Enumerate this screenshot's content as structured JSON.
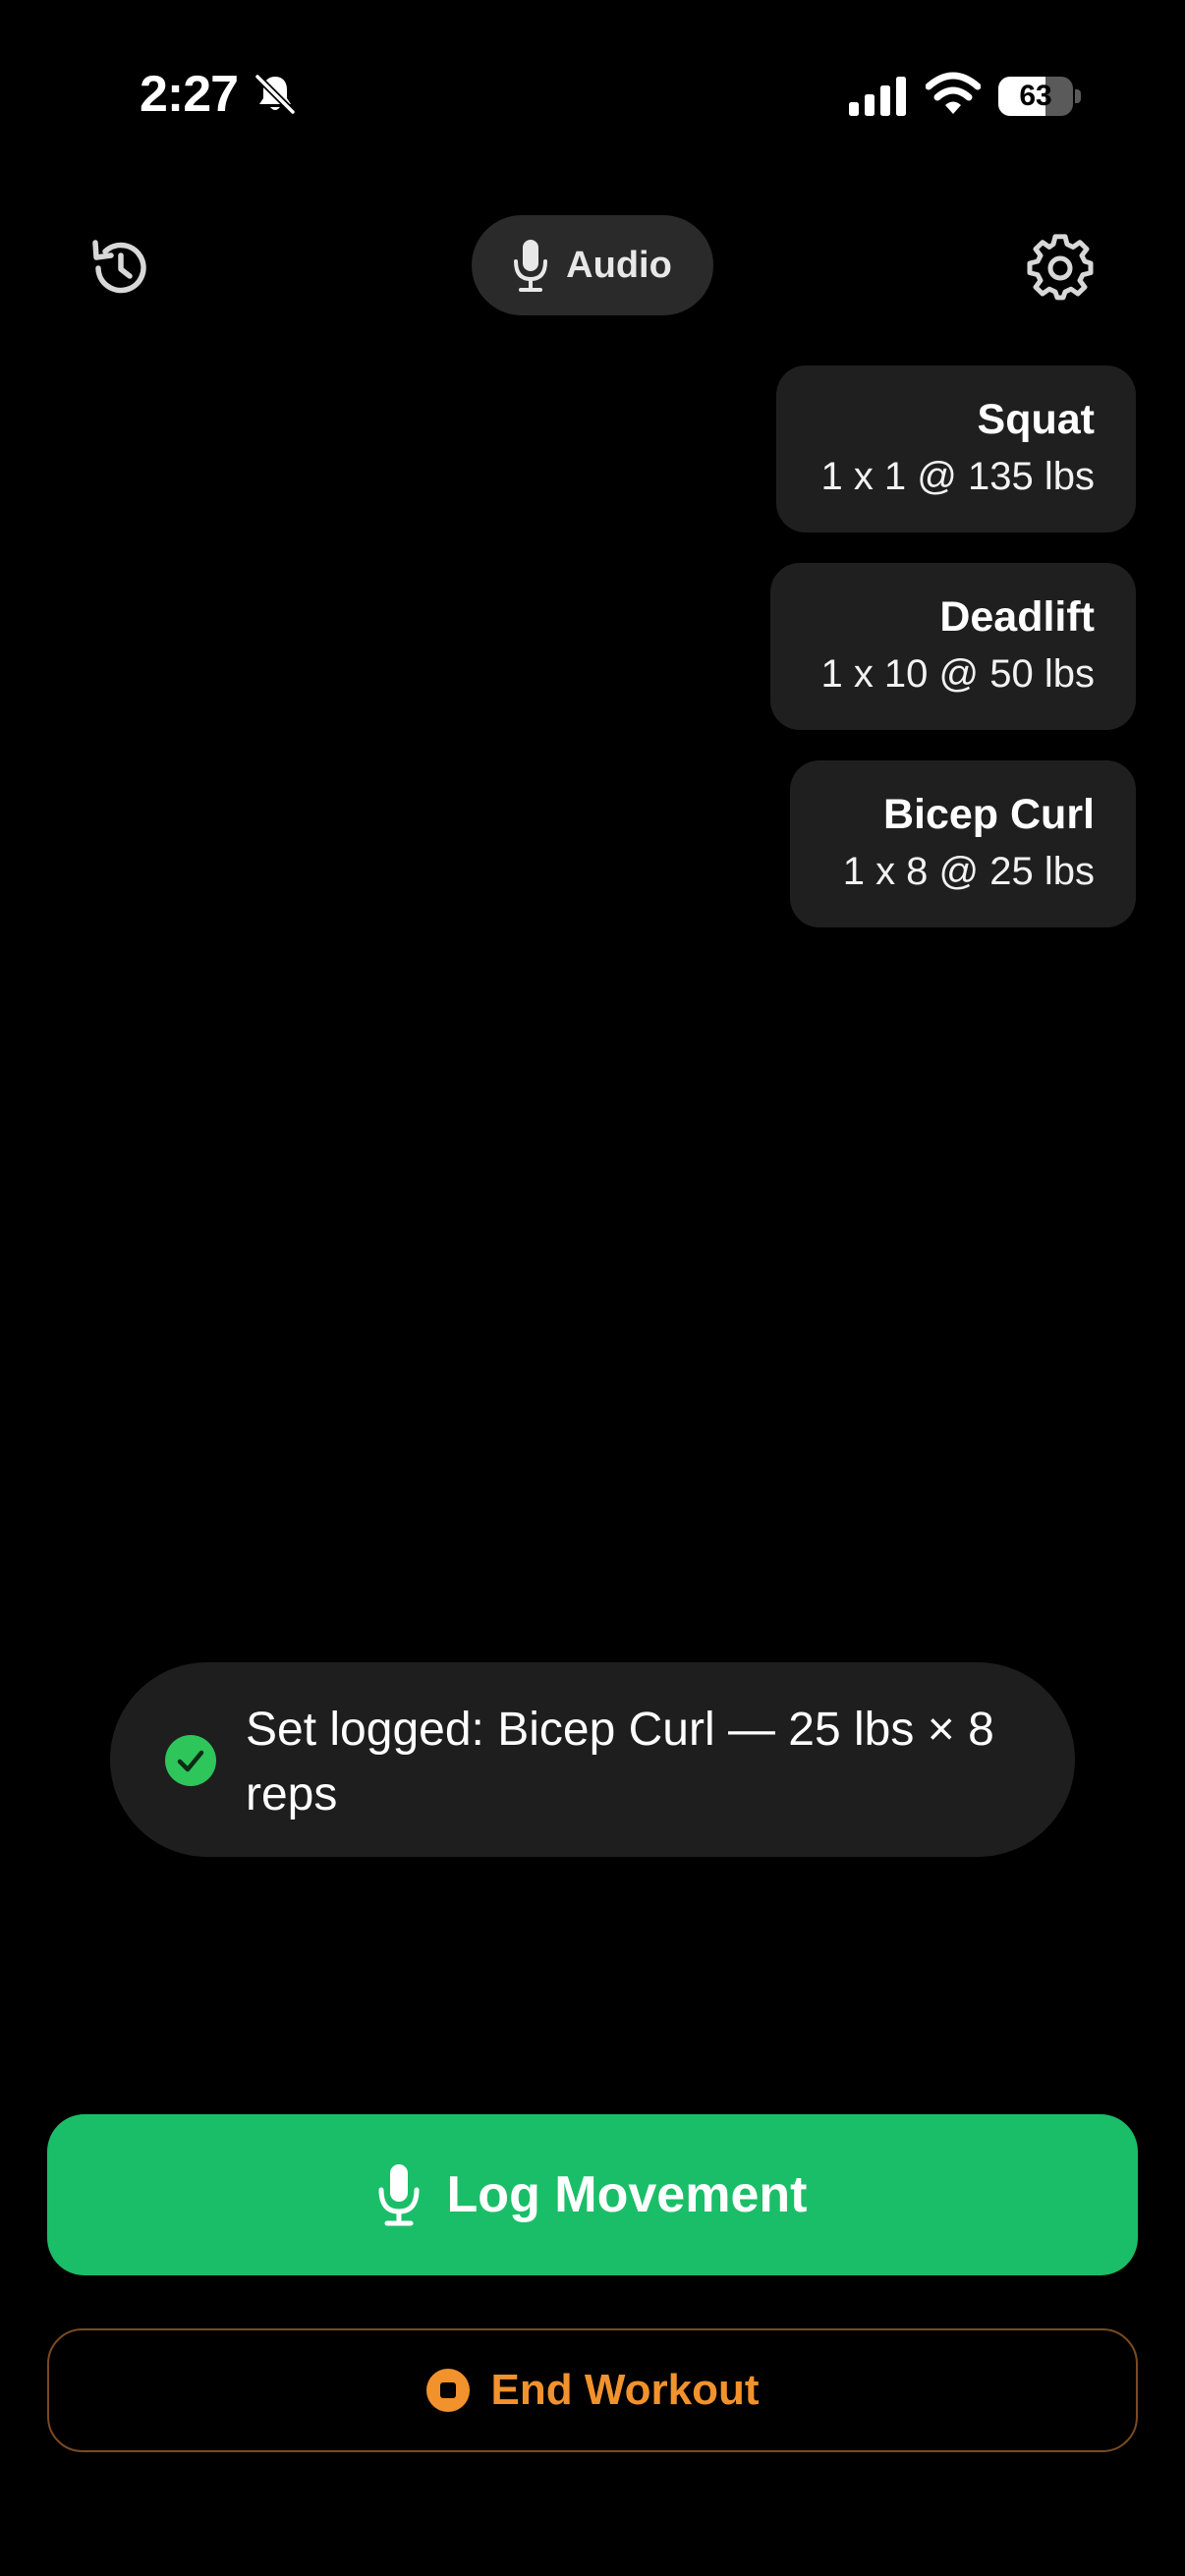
{
  "status_bar": {
    "time": "2:27",
    "battery_level": "63",
    "battery_fraction": 0.63
  },
  "top_bar": {
    "history_icon": "history-icon",
    "audio_label": "Audio",
    "settings_icon": "gear-icon"
  },
  "sets": [
    {
      "exercise": "Squat",
      "detail": "1 x 1 @ 135 lbs"
    },
    {
      "exercise": "Deadlift",
      "detail": "1 x 10 @ 50 lbs"
    },
    {
      "exercise": "Bicep Curl",
      "detail": "1 x 8 @ 25 lbs"
    }
  ],
  "toast": {
    "message": "Set logged: Bicep Curl — 25 lbs × 8 reps",
    "icon": "check-circle-icon"
  },
  "actions": {
    "log_label": "Log Movement",
    "end_label": "End Workout"
  },
  "colors": {
    "accent_green": "#1bbe68",
    "end_orange": "#f2922c",
    "check_green": "#2ec55a",
    "card_bg": "#1f1f1f"
  }
}
